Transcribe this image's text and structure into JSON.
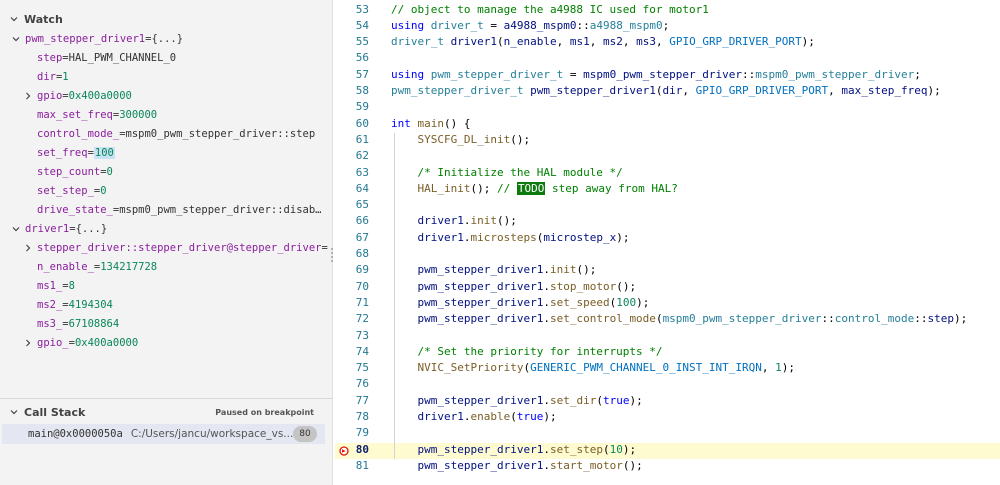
{
  "watch": {
    "title": "Watch",
    "items": [
      {
        "indent": 0,
        "twist": "open",
        "name": "pwm_stepper_driver1",
        "value": "{...}",
        "valcls": ""
      },
      {
        "indent": 1,
        "twist": "none",
        "name": "step",
        "value": "HAL_PWM_CHANNEL_0",
        "valcls": ""
      },
      {
        "indent": 1,
        "twist": "none",
        "name": "dir",
        "value": "1",
        "valcls": "num"
      },
      {
        "indent": 1,
        "twist": "closed",
        "name": "gpio",
        "value": "0x400a0000",
        "valcls": "num"
      },
      {
        "indent": 1,
        "twist": "none",
        "name": "max_set_freq",
        "value": "300000",
        "valcls": "num"
      },
      {
        "indent": 1,
        "twist": "none",
        "name": "control_mode_",
        "value": "mspm0_pwm_stepper_driver::step",
        "valcls": ""
      },
      {
        "indent": 1,
        "twist": "none",
        "name": "set_freq",
        "value": "100",
        "valcls": "hl"
      },
      {
        "indent": 1,
        "twist": "none",
        "name": "step_count",
        "value": "0",
        "valcls": "num"
      },
      {
        "indent": 1,
        "twist": "none",
        "name": "set_step_",
        "value": "0",
        "valcls": "num"
      },
      {
        "indent": 1,
        "twist": "none",
        "name": "drive_state_",
        "value": "mspm0_pwm_stepper_driver::disab…",
        "valcls": ""
      },
      {
        "indent": 0,
        "twist": "open",
        "name": "driver1",
        "value": "{...}",
        "valcls": ""
      },
      {
        "indent": 1,
        "twist": "closed",
        "name": "stepper_driver::stepper_driver@stepper_driver",
        "value": "",
        "valcls": ""
      },
      {
        "indent": 1,
        "twist": "none",
        "name": "n_enable_",
        "value": "134217728",
        "valcls": "num"
      },
      {
        "indent": 1,
        "twist": "none",
        "name": "ms1_",
        "value": "8",
        "valcls": "num"
      },
      {
        "indent": 1,
        "twist": "none",
        "name": "ms2_",
        "value": "4194304",
        "valcls": "num"
      },
      {
        "indent": 1,
        "twist": "none",
        "name": "ms3_",
        "value": "67108864",
        "valcls": "num"
      },
      {
        "indent": 1,
        "twist": "closed",
        "name": "gpio_",
        "value": "0x400a0000",
        "valcls": "num"
      }
    ]
  },
  "callstack": {
    "title": "Call Stack",
    "status": "Paused on breakpoint",
    "frame_fn": "main@0x0000050a",
    "frame_path": "C:/Users/jancu/workspace_vs...",
    "frame_badge": "80"
  },
  "editor": {
    "current_line": "80",
    "lines": [
      {
        "n": "53",
        "tokens": [
          [
            "cm",
            "// object to manage the a4988 IC used for motor1"
          ]
        ]
      },
      {
        "n": "54",
        "tokens": [
          [
            "kw",
            "using "
          ],
          [
            "ty",
            "driver_t"
          ],
          [
            "pl",
            " = "
          ],
          [
            "vr",
            "a4988_mspm0"
          ],
          [
            "pl",
            "::"
          ],
          [
            "ty",
            "a4988_mspm0"
          ],
          [
            "pl",
            ";"
          ]
        ]
      },
      {
        "n": "55",
        "tokens": [
          [
            "ty",
            "driver_t "
          ],
          [
            "vr",
            "driver1"
          ],
          [
            "pl",
            "("
          ],
          [
            "vr",
            "n_enable"
          ],
          [
            "pl",
            ", "
          ],
          [
            "vr",
            "ms1"
          ],
          [
            "pl",
            ", "
          ],
          [
            "vr",
            "ms2"
          ],
          [
            "pl",
            ", "
          ],
          [
            "vr",
            "ms3"
          ],
          [
            "pl",
            ", "
          ],
          [
            "mac",
            "GPIO_GRP_DRIVER_PORT"
          ],
          [
            "pl",
            ");"
          ]
        ]
      },
      {
        "n": "56",
        "tokens": []
      },
      {
        "n": "57",
        "tokens": [
          [
            "kw",
            "using "
          ],
          [
            "ty",
            "pwm_stepper_driver_t"
          ],
          [
            "pl",
            " = "
          ],
          [
            "vr",
            "mspm0_pwm_stepper_driver"
          ],
          [
            "pl",
            "::"
          ],
          [
            "ty",
            "mspm0_pwm_stepper_driver"
          ],
          [
            "pl",
            ";"
          ]
        ]
      },
      {
        "n": "58",
        "tokens": [
          [
            "ty",
            "pwm_stepper_driver_t "
          ],
          [
            "vr",
            "pwm_stepper_driver1"
          ],
          [
            "pl",
            "("
          ],
          [
            "vr",
            "dir"
          ],
          [
            "pl",
            ", "
          ],
          [
            "mac",
            "GPIO_GRP_DRIVER_PORT"
          ],
          [
            "pl",
            ", "
          ],
          [
            "vr",
            "max_step_freq"
          ],
          [
            "pl",
            ");"
          ]
        ]
      },
      {
        "n": "59",
        "tokens": []
      },
      {
        "n": "60",
        "tokens": [
          [
            "kw",
            "int "
          ],
          [
            "fnc",
            "main"
          ],
          [
            "pl",
            "() "
          ],
          [
            "pl",
            "{"
          ]
        ]
      },
      {
        "n": "61",
        "tokens": [
          [
            "pl",
            "    "
          ],
          [
            "fnc",
            "SYSCFG_DL_init"
          ],
          [
            "pl",
            "();"
          ]
        ]
      },
      {
        "n": "62",
        "tokens": []
      },
      {
        "n": "63",
        "tokens": [
          [
            "pl",
            "    "
          ],
          [
            "cm",
            "/* Initialize the HAL module */"
          ]
        ]
      },
      {
        "n": "64",
        "tokens": [
          [
            "pl",
            "    "
          ],
          [
            "fnc",
            "HAL_init"
          ],
          [
            "pl",
            "(); "
          ],
          [
            "cm",
            "// "
          ],
          [
            "todo",
            "TODO"
          ],
          [
            "cm",
            " step away from HAL?"
          ]
        ]
      },
      {
        "n": "65",
        "tokens": []
      },
      {
        "n": "66",
        "tokens": [
          [
            "pl",
            "    "
          ],
          [
            "vr",
            "driver1"
          ],
          [
            "pl",
            "."
          ],
          [
            "fnc",
            "init"
          ],
          [
            "pl",
            "();"
          ]
        ]
      },
      {
        "n": "67",
        "tokens": [
          [
            "pl",
            "    "
          ],
          [
            "vr",
            "driver1"
          ],
          [
            "pl",
            "."
          ],
          [
            "fnc",
            "microsteps"
          ],
          [
            "pl",
            "("
          ],
          [
            "vr",
            "microstep_x"
          ],
          [
            "pl",
            ");"
          ]
        ]
      },
      {
        "n": "68",
        "tokens": []
      },
      {
        "n": "69",
        "tokens": [
          [
            "pl",
            "    "
          ],
          [
            "vr",
            "pwm_stepper_driver1"
          ],
          [
            "pl",
            "."
          ],
          [
            "fnc",
            "init"
          ],
          [
            "pl",
            "();"
          ]
        ]
      },
      {
        "n": "70",
        "tokens": [
          [
            "pl",
            "    "
          ],
          [
            "vr",
            "pwm_stepper_driver1"
          ],
          [
            "pl",
            "."
          ],
          [
            "fnc",
            "stop_motor"
          ],
          [
            "pl",
            "();"
          ]
        ]
      },
      {
        "n": "71",
        "tokens": [
          [
            "pl",
            "    "
          ],
          [
            "vr",
            "pwm_stepper_driver1"
          ],
          [
            "pl",
            "."
          ],
          [
            "fnc",
            "set_speed"
          ],
          [
            "pl",
            "("
          ],
          [
            "nu",
            "100"
          ],
          [
            "pl",
            ");"
          ]
        ]
      },
      {
        "n": "72",
        "tokens": [
          [
            "pl",
            "    "
          ],
          [
            "vr",
            "pwm_stepper_driver1"
          ],
          [
            "pl",
            "."
          ],
          [
            "fnc",
            "set_control_mode"
          ],
          [
            "pl",
            "("
          ],
          [
            "ty",
            "mspm0_pwm_stepper_driver"
          ],
          [
            "pl",
            "::"
          ],
          [
            "ty",
            "control_mode"
          ],
          [
            "pl",
            "::"
          ],
          [
            "vr",
            "step"
          ],
          [
            "pl",
            ");"
          ]
        ]
      },
      {
        "n": "73",
        "tokens": []
      },
      {
        "n": "74",
        "tokens": [
          [
            "pl",
            "    "
          ],
          [
            "cm",
            "/* Set the priority for interrupts */"
          ]
        ]
      },
      {
        "n": "75",
        "tokens": [
          [
            "pl",
            "    "
          ],
          [
            "fnc",
            "NVIC_SetPriority"
          ],
          [
            "pl",
            "("
          ],
          [
            "mac",
            "GENERIC_PWM_CHANNEL_0_INST_INT_IRQN"
          ],
          [
            "pl",
            ", "
          ],
          [
            "nu",
            "1"
          ],
          [
            "pl",
            ");"
          ]
        ]
      },
      {
        "n": "76",
        "tokens": []
      },
      {
        "n": "77",
        "tokens": [
          [
            "pl",
            "    "
          ],
          [
            "vr",
            "pwm_stepper_driver1"
          ],
          [
            "pl",
            "."
          ],
          [
            "fnc",
            "set_dir"
          ],
          [
            "pl",
            "("
          ],
          [
            "kw",
            "true"
          ],
          [
            "pl",
            ");"
          ]
        ]
      },
      {
        "n": "78",
        "tokens": [
          [
            "pl",
            "    "
          ],
          [
            "vr",
            "driver1"
          ],
          [
            "pl",
            "."
          ],
          [
            "fnc",
            "enable"
          ],
          [
            "pl",
            "("
          ],
          [
            "kw",
            "true"
          ],
          [
            "pl",
            ");"
          ]
        ]
      },
      {
        "n": "79",
        "tokens": []
      },
      {
        "n": "80",
        "tokens": [
          [
            "pl",
            "    "
          ],
          [
            "vr",
            "pwm_stepper_driver1"
          ],
          [
            "pl",
            "."
          ],
          [
            "fnc",
            "set_step"
          ],
          [
            "pl",
            "("
          ],
          [
            "nu",
            "10"
          ],
          [
            "pl",
            ");"
          ]
        ]
      },
      {
        "n": "81",
        "tokens": [
          [
            "pl",
            "    "
          ],
          [
            "vr",
            "pwm_stepper_driver1"
          ],
          [
            "pl",
            "."
          ],
          [
            "fnc",
            "start_motor"
          ],
          [
            "pl",
            "();"
          ]
        ]
      }
    ]
  }
}
